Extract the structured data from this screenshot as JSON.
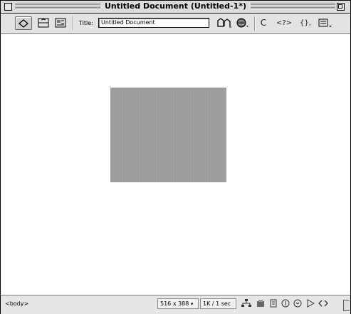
{
  "window": {
    "title": "Untitled Document (Untitled-1*)"
  },
  "toolbar": {
    "title_label": "Title:",
    "title_value": "Untitled Document",
    "refresh_glyph": "C",
    "code_glyph": "<?>",
    "braces_glyph": "{},",
    "buttons": [
      "show-code-view",
      "show-code-and-design",
      "show-design-view",
      "file-management",
      "preview-in-browser",
      "refresh",
      "reference",
      "code-navigation",
      "view-options"
    ]
  },
  "document": {
    "placeholder_color": "#9f9f9f"
  },
  "statusbar": {
    "tag": "<body>",
    "window_size": "516 x 388",
    "download": "1K / 1 sec",
    "launcher_icons": [
      "site-icon",
      "assets-icon",
      "html-styles-icon",
      "css-styles-icon",
      "behaviors-icon",
      "timelines-icon",
      "html-source-icon"
    ]
  }
}
